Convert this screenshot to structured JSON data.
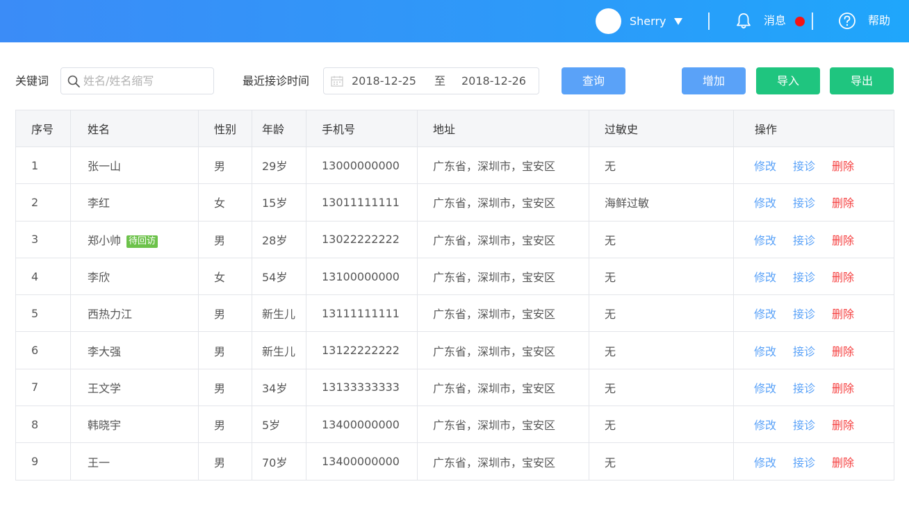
{
  "header": {
    "username": "Sherry",
    "messages_label": "消息",
    "help_label": "帮助"
  },
  "toolbar": {
    "keyword_label": "关键词",
    "search_placeholder": "姓名/姓名缩写",
    "date_label": "最近接诊时间",
    "date_start": "2018-12-25",
    "date_separator": "至",
    "date_end": "2018-12-26",
    "query_button": "查询",
    "add_button": "增加",
    "import_button": "导入",
    "export_button": "导出"
  },
  "table": {
    "headers": [
      "序号",
      "姓名",
      "性别",
      "年龄",
      "手机号",
      "地址",
      "过敏史",
      "操作"
    ],
    "actions": {
      "edit": "修改",
      "visit": "接诊",
      "delete": "删除"
    },
    "rows": [
      {
        "no": "1",
        "name": "张一山",
        "tag": "",
        "gender": "男",
        "age": "29岁",
        "phone": "13000000000",
        "address": "广东省，深圳市，宝安区",
        "allergy": "无"
      },
      {
        "no": "2",
        "name": "李红",
        "tag": "",
        "gender": "女",
        "age": "15岁",
        "phone": "13011111111",
        "address": "广东省，深圳市，宝安区",
        "allergy": "海鲜过敏"
      },
      {
        "no": "3",
        "name": "郑小帅",
        "tag": "待回访",
        "gender": "男",
        "age": "28岁",
        "phone": "13022222222",
        "address": "广东省，深圳市，宝安区",
        "allergy": "无"
      },
      {
        "no": "4",
        "name": "李欣",
        "tag": "",
        "gender": "女",
        "age": "54岁",
        "phone": "13100000000",
        "address": "广东省，深圳市，宝安区",
        "allergy": "无"
      },
      {
        "no": "5",
        "name": "西热力江",
        "tag": "",
        "gender": "男",
        "age": "新生儿",
        "phone": "13111111111",
        "address": "广东省，深圳市，宝安区",
        "allergy": "无"
      },
      {
        "no": "6",
        "name": "李大强",
        "tag": "",
        "gender": "男",
        "age": "新生儿",
        "phone": "13122222222",
        "address": "广东省，深圳市，宝安区",
        "allergy": "无"
      },
      {
        "no": "7",
        "name": "王文学",
        "tag": "",
        "gender": "男",
        "age": "34岁",
        "phone": "13133333333",
        "address": "广东省，深圳市，宝安区",
        "allergy": "无"
      },
      {
        "no": "8",
        "name": "韩晓宇",
        "tag": "",
        "gender": "男",
        "age": "5岁",
        "phone": "13400000000",
        "address": "广东省，深圳市，宝安区",
        "allergy": "无"
      },
      {
        "no": "9",
        "name": "王一",
        "tag": "",
        "gender": "男",
        "age": "70岁",
        "phone": "13400000000",
        "address": "广东省，深圳市，宝安区",
        "allergy": "无"
      }
    ]
  },
  "colors": {
    "header_gradient_start": "#3b8cf7",
    "header_gradient_end": "#1fa6fb",
    "primary_blue": "#5aa2f8",
    "action_green": "#1fc57f",
    "delete_red": "#f54040",
    "tag_green": "#6cc24a",
    "notification_dot": "#f51313"
  },
  "icons": {
    "user": "avatar",
    "dropdown": "caret-down-icon",
    "notifications": "bell-icon",
    "help": "question-circle-icon",
    "search": "search-icon",
    "date": "calendar-icon"
  }
}
